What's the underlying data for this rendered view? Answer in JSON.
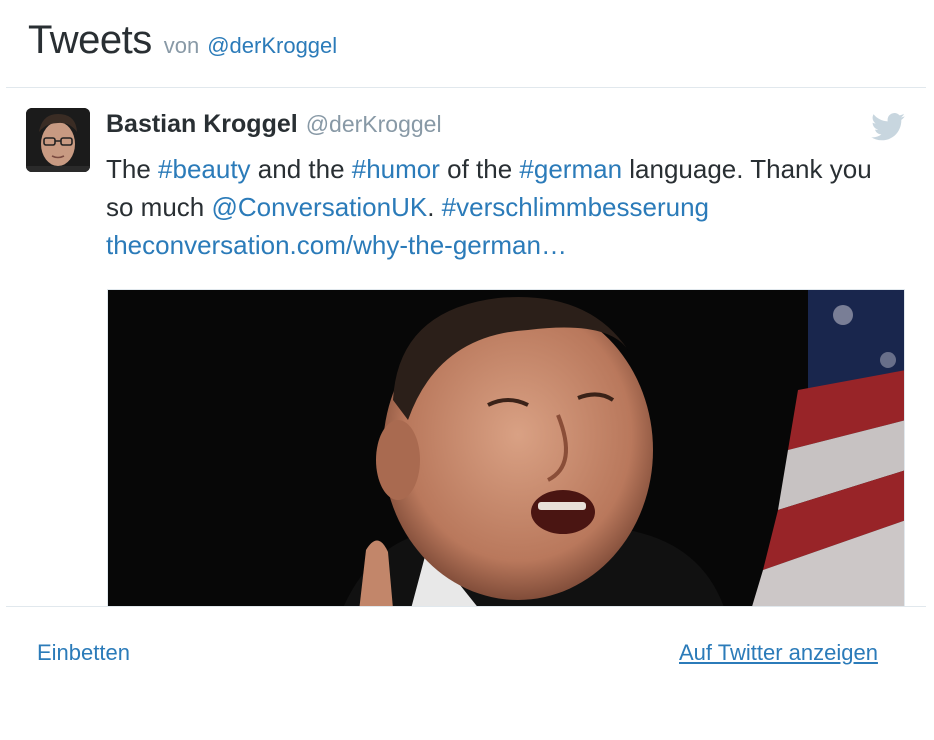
{
  "header": {
    "title": "Tweets",
    "by_label": "von",
    "handle": "@derKroggel"
  },
  "tweet": {
    "author_name": "Bastian Kroggel",
    "author_handle": "@derKroggel",
    "text_segments": {
      "s1": "The ",
      "s2": "#beauty",
      "s3": " and the ",
      "s4": "#humor",
      "s5": " of the ",
      "s6": "#german",
      "s7": " language. Thank you so much ",
      "s8": "@ConversationUK",
      "s9": ". ",
      "s10": "#verschlimmbesserung",
      "s11": "theconversation.com/why-the-german…"
    },
    "icon": "twitter-bird-icon",
    "media_icon": "photo-media"
  },
  "footer": {
    "embed_label": "Einbetten",
    "view_label": "Auf Twitter anzeigen"
  },
  "colors": {
    "link": "#2b7bb9",
    "text": "#292f33",
    "muted": "#8899a6",
    "divider": "#e1e8ed"
  }
}
